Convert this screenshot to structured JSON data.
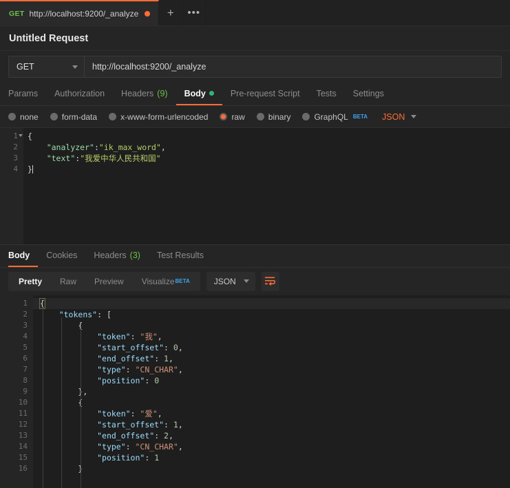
{
  "tabbar": {
    "request_tab": {
      "method": "GET",
      "url": "http://localhost:9200/_analyze",
      "unsaved_indicator": "unsaved-dot"
    },
    "new_tab_label": "+",
    "more_label": "•••"
  },
  "request": {
    "title": "Untitled Request",
    "method": "GET",
    "url": "http://localhost:9200/_analyze",
    "tabs": [
      {
        "label": "Params",
        "active": false
      },
      {
        "label": "Authorization",
        "active": false
      },
      {
        "label": "Headers",
        "count": "(9)",
        "active": false
      },
      {
        "label": "Body",
        "active": true,
        "has_dot": true
      },
      {
        "label": "Pre-request Script",
        "active": false
      },
      {
        "label": "Tests",
        "active": false
      },
      {
        "label": "Settings",
        "active": false
      }
    ],
    "body_types": [
      {
        "label": "none",
        "selected": false
      },
      {
        "label": "form-data",
        "selected": false
      },
      {
        "label": "x-www-form-urlencoded",
        "selected": false
      },
      {
        "label": "raw",
        "selected": true
      },
      {
        "label": "binary",
        "selected": false
      },
      {
        "label": "GraphQL",
        "selected": false,
        "badge": "BETA"
      }
    ],
    "content_type": "JSON",
    "editor": {
      "line_numbers": [
        "1",
        "2",
        "3",
        "4"
      ],
      "lines": [
        {
          "open": "{"
        },
        {
          "key": "\"analyzer\"",
          "colon": ":",
          "value": "\"ik_max_word\"",
          "comma": ","
        },
        {
          "key": "\"text\"",
          "colon": ":",
          "value": "\"我爱中华人民共和国\"",
          "comma": ""
        },
        {
          "close": "}"
        }
      ]
    }
  },
  "response": {
    "tabs": [
      {
        "label": "Body",
        "active": true
      },
      {
        "label": "Cookies",
        "active": false
      },
      {
        "label": "Headers",
        "count": "(3)",
        "active": false
      },
      {
        "label": "Test Results",
        "active": false
      }
    ],
    "view_modes": [
      {
        "label": "Pretty",
        "active": true
      },
      {
        "label": "Raw",
        "active": false
      },
      {
        "label": "Preview",
        "active": false
      },
      {
        "label": "Visualize",
        "active": false,
        "badge": "BETA"
      }
    ],
    "format": "JSON",
    "wrap_icon": "word-wrap-icon",
    "editor": {
      "line_numbers": [
        "1",
        "2",
        "3",
        "4",
        "5",
        "6",
        "7",
        "8",
        "9",
        "10",
        "11",
        "12",
        "13",
        "14",
        "15",
        "16"
      ],
      "lines": [
        {
          "indent": 0,
          "punc": "{"
        },
        {
          "indent": 1,
          "key": "\"tokens\"",
          "colon": ": ",
          "punc": "["
        },
        {
          "indent": 2,
          "punc": "{"
        },
        {
          "indent": 3,
          "key": "\"token\"",
          "colon": ": ",
          "str": "\"我\"",
          "punc": ","
        },
        {
          "indent": 3,
          "key": "\"start_offset\"",
          "colon": ": ",
          "num": "0",
          "punc": ","
        },
        {
          "indent": 3,
          "key": "\"end_offset\"",
          "colon": ": ",
          "num": "1",
          "punc": ","
        },
        {
          "indent": 3,
          "key": "\"type\"",
          "colon": ": ",
          "str": "\"CN_CHAR\"",
          "punc": ","
        },
        {
          "indent": 3,
          "key": "\"position\"",
          "colon": ": ",
          "num": "0",
          "punc": ""
        },
        {
          "indent": 2,
          "punc": "},"
        },
        {
          "indent": 2,
          "punc": "{"
        },
        {
          "indent": 3,
          "key": "\"token\"",
          "colon": ": ",
          "str": "\"爱\"",
          "punc": ","
        },
        {
          "indent": 3,
          "key": "\"start_offset\"",
          "colon": ": ",
          "num": "1",
          "punc": ","
        },
        {
          "indent": 3,
          "key": "\"end_offset\"",
          "colon": ": ",
          "num": "2",
          "punc": ","
        },
        {
          "indent": 3,
          "key": "\"type\"",
          "colon": ": ",
          "str": "\"CN_CHAR\"",
          "punc": ","
        },
        {
          "indent": 3,
          "key": "\"position\"",
          "colon": ": ",
          "num": "1",
          "punc": ""
        },
        {
          "indent": 2,
          "punc": "}"
        }
      ]
    }
  },
  "colors": {
    "accent": "#ff6c37",
    "method_green": "#6cc24a",
    "badge_blue": "#3ba5f0",
    "status_dot": "#2eb67d"
  }
}
